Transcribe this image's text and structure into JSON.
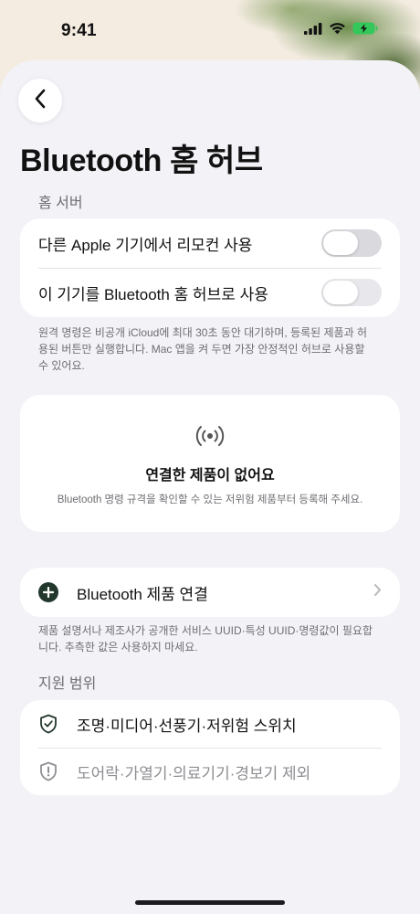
{
  "status_bar": {
    "time": "9:41",
    "icons": [
      "signal-icon",
      "wifi-icon",
      "battery-charging-icon"
    ]
  },
  "nav": {
    "back_icon": "chevron-left-icon"
  },
  "page": {
    "title": "Bluetooth 홈 허브"
  },
  "home_server": {
    "section_label": "홈 서버",
    "toggles": [
      {
        "label": "다른 Apple 기기에서 리모컨 사용",
        "on": false
      },
      {
        "label": "이 기기를 Bluetooth 홈 허브로 사용",
        "on": false
      }
    ],
    "footnote": "원격 명령은 비공개 iCloud에 최대 30초 동안 대기하며, 등록된 제품과 허용된 버튼만 실행합니다. Mac 앱을 켜 두면 가장 안정적인 허브로 사용할 수 있어요."
  },
  "empty_state": {
    "icon": "broadcast-icon",
    "title": "연결한 제품이 없어요",
    "description": "Bluetooth 명령 규격을 확인할 수 있는 저위험 제품부터 등록해 주세요."
  },
  "connect": {
    "icon": "plus-circle-icon",
    "label": "Bluetooth 제품 연결",
    "chevron": "chevron-right-icon",
    "footnote": "제품 설명서나 제조사가 공개한 서비스 UUID·특성 UUID·명령값이 필요합니다. 추측한 값은 사용하지 마세요."
  },
  "support_scope": {
    "section_label": "지원 범위",
    "items": [
      {
        "icon": "shield-check-icon",
        "label": "조명·미디어·선풍기·저위험 스위치"
      },
      {
        "icon": "shield-exclamation-icon",
        "label": "도어락·가열기·의료기기·경보기 제외"
      }
    ]
  },
  "colors": {
    "accent_dark_green": "#22382c",
    "battery_green": "#34c759",
    "background": "#f2f2f7",
    "card": "#ffffff",
    "secondary_text": "#6e6e73"
  }
}
